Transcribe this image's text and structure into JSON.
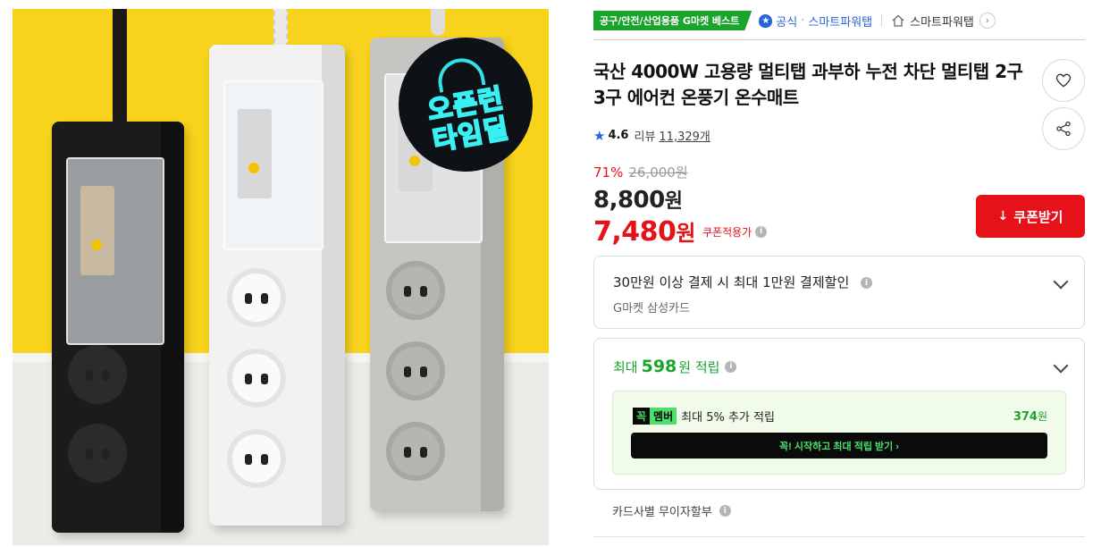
{
  "image": {
    "deal_badge_line1": "오픈런",
    "deal_badge_line2": "타임딜",
    "background_color": "#f7d31c",
    "badge_accent": "#39f0f3"
  },
  "header": {
    "category_badge": "공구/안전/산업용품 G마켓 베스트",
    "official_label": "공식",
    "official_store": "스마트파워탭",
    "store_link": "스마트파워탭",
    "official_color": "#2a65d8",
    "category_color": "#1aa42c"
  },
  "product": {
    "title": "국산 4000W 고용량 멀티탭 과부하 누전 차단 멀티탭 2구 3구 에어컨 온풍기 온수매트",
    "rating": "4.6",
    "review_label": "리뷰",
    "review_count": "11,329개"
  },
  "price": {
    "discount_rate": "71%",
    "original_price": "26,000원",
    "sale_price": "8,800",
    "sale_unit": "원",
    "coupon_price": "7,480",
    "coupon_unit": "원",
    "coupon_note": "쿠폰적용가",
    "accent": "#e5121a"
  },
  "actions": {
    "coupon_button": "쿠폰받기"
  },
  "card_discount": {
    "headline": "30만원 이상 결제 시 최대 1만원 결제할인",
    "card_name": "G마켓 삼성카드"
  },
  "points": {
    "prefix": "최대",
    "amount": "598",
    "suffix": "원 적립",
    "member_logo_a": "꼭",
    "member_logo_b": "멤버",
    "member_text": "최대 5% 추가 적립",
    "member_points": "374",
    "member_points_unit": "원",
    "member_cta": "꼭! 시작하고 최대 적립 받기  ›"
  },
  "installment": {
    "label": "카드사별 무이자할부"
  }
}
